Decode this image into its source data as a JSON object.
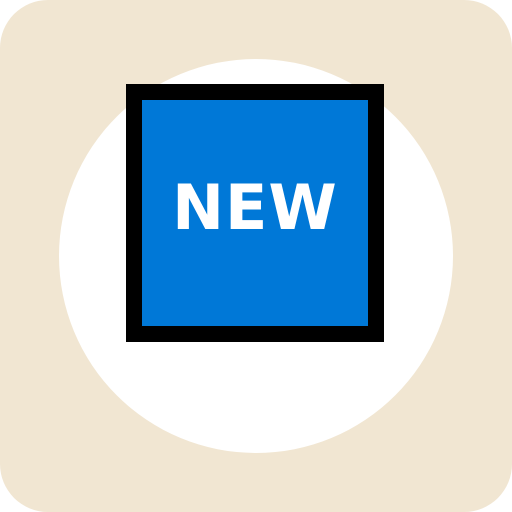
{
  "icon": {
    "name": "new-badge-icon",
    "badge_label": "NEW",
    "colors": {
      "background": "#f1e6d2",
      "halo": "#ffffff",
      "badge_border": "#000000",
      "badge_fill": "#0078d7",
      "badge_text": "#ffffff"
    }
  }
}
